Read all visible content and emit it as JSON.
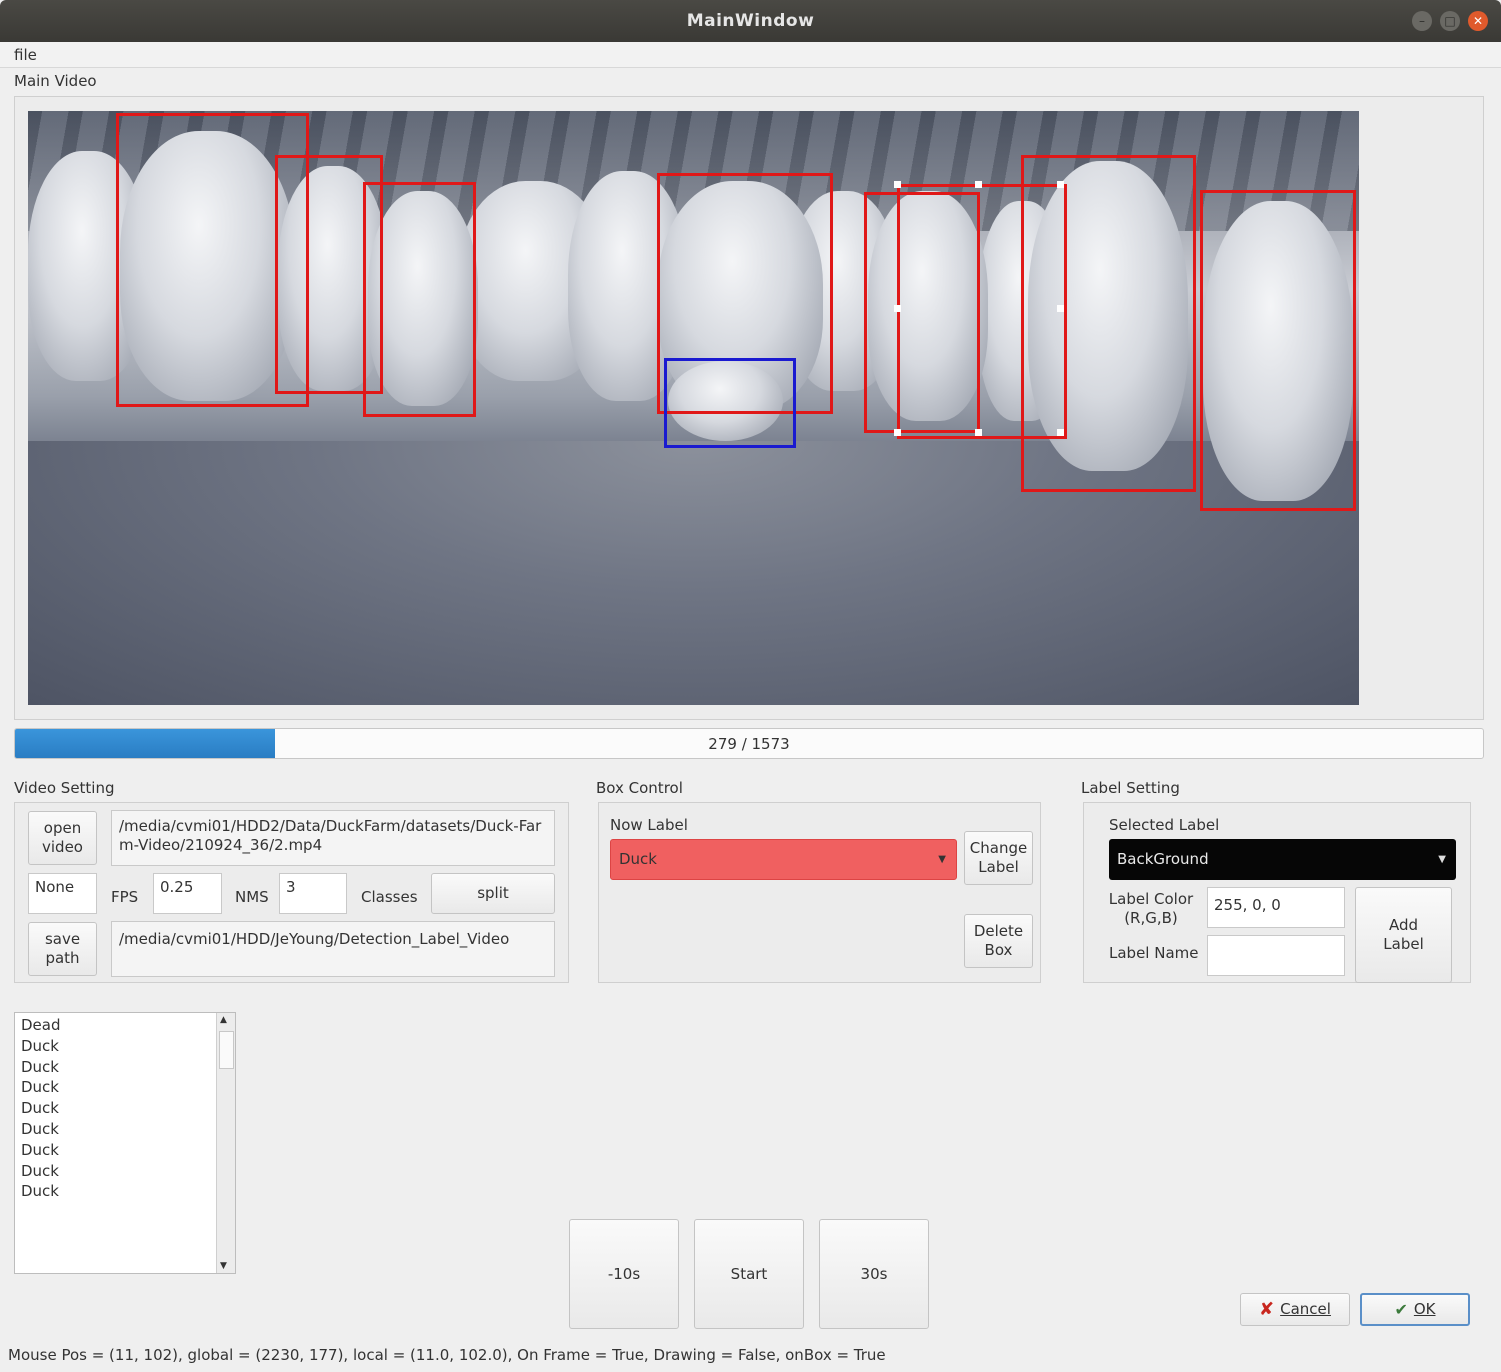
{
  "window": {
    "title": "MainWindow"
  },
  "menu": {
    "file": "file"
  },
  "main_video": {
    "label": "Main Video"
  },
  "progress": {
    "current": 279,
    "total": 1573,
    "text": "279 / 1573",
    "fraction": 0.177
  },
  "video_setting": {
    "title": "Video Setting",
    "open_video": "open\nvideo",
    "video_path": "/media/cvmi01/HDD2/Data/DuckFarm/datasets/Duck-Farm-Video/210924_36/2.mp4",
    "none_label": "None",
    "fps_label": "FPS",
    "fps_value": "0.25",
    "nms_label": "NMS",
    "nms_value": "3",
    "classes_label": "Classes",
    "split_button": "split",
    "save_path": "save\npath",
    "save_path_value": "/media/cvmi01/HDD/JeYoung/Detection_Label_Video"
  },
  "box_control": {
    "title": "Box Control",
    "now_label": "Now Label",
    "selected": "Duck",
    "selected_color": "#f06060",
    "change_label": "Change\nLabel",
    "delete_box": "Delete\nBox"
  },
  "label_setting": {
    "title": "Label Setting",
    "selected_label_title": "Selected Label",
    "selected": "BackGround",
    "label_color_label": "Label Color\n(R,G,B)",
    "label_color_value": "255, 0, 0",
    "label_name_label": "Label Name",
    "label_name_value": "",
    "add_label": "Add\nLabel"
  },
  "label_list": [
    "Dead",
    "Duck",
    "Duck",
    "Duck",
    "Duck",
    "Duck",
    "Duck",
    "Duck",
    "Duck"
  ],
  "playback": {
    "back": "-10s",
    "start": "Start",
    "forward": "30s"
  },
  "dialog": {
    "cancel": "Cancel",
    "ok": "OK"
  },
  "status": "Mouse Pos = (11, 102), global = (2230, 177), local = (11.0, 102.0), On Frame = True, Drawing = False, onBox = True",
  "colors": {
    "box_duck": "#e01818",
    "box_dead": "#1a1ad0",
    "progress": "#2a86cf"
  }
}
